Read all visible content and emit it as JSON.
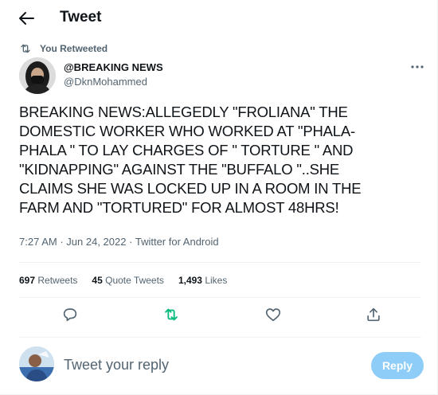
{
  "header": {
    "title": "Tweet"
  },
  "retweet_context": {
    "label": "You Retweeted"
  },
  "author": {
    "name": "@BREAKING NEWS",
    "handle": "@DknMohammed"
  },
  "tweet": {
    "lines": [
      "BREAKING NEWS:ALLEGEDLY \"FROLIANA\" THE",
      "DOMESTIC WORKER WHO WORKED AT \"PHALA-",
      "PHALA \" TO LAY CHARGES OF \" TORTURE \" AND",
      "\"KIDNAPPING\" AGAINST THE \"BUFFALO \"..SHE",
      "CLAIMS SHE WAS LOCKED UP IN A ROOM IN THE",
      "FARM AND \"TORTURED\" FOR ALMOST 48HRS!"
    ],
    "time": "7:27 AM",
    "date": "Jun 24, 2022",
    "separator": "·",
    "source": "Twitter for Android"
  },
  "stats": {
    "retweets_count": "697",
    "retweets_label": "Retweets",
    "quotes_count": "45",
    "quotes_label": "Quote Tweets",
    "likes_count": "1,493",
    "likes_label": "Likes"
  },
  "reply": {
    "placeholder": "Tweet your reply",
    "button_label": "Reply"
  },
  "colors": {
    "accent": "#1d9bf0",
    "retweet_green": "#00ba7c",
    "muted": "#536471",
    "reply_button_disabled": "#8ecdf8"
  },
  "icons": {
    "back": "arrow-left-icon",
    "retweet_context": "retweet-icon",
    "more": "more-horizontal-icon",
    "reply": "reply-icon",
    "retweet": "retweet-icon",
    "like": "heart-icon",
    "share": "share-icon"
  }
}
